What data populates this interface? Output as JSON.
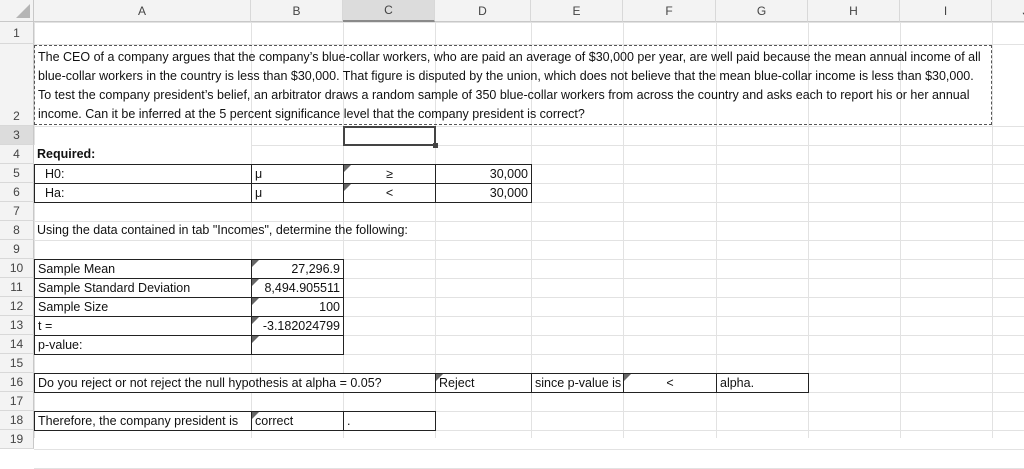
{
  "columns": [
    "A",
    "B",
    "C",
    "D",
    "E",
    "F",
    "G",
    "H",
    "I",
    "J"
  ],
  "rows": [
    "1",
    "2",
    "3",
    "4",
    "5",
    "6",
    "7",
    "8",
    "9",
    "10",
    "11",
    "12",
    "13",
    "14",
    "15",
    "16",
    "17",
    "18",
    "19"
  ],
  "problem_text": "The CEO of a company argues that the company’s blue-collar workers, who are paid an average of $30,000 per year, are well paid because the mean annual income of all blue-collar workers in the country is less than $30,000. That figure is disputed by the union, which does not believe that the mean blue-collar income is less than $30,000. To test the company president’s belief, an arbitrator draws a random sample of 350 blue-collar workers from across the country and asks each to report his or her annual income. Can it be inferred at the 5 percent significance level that the company president is correct?",
  "required_label": "Required:",
  "hypotheses": [
    {
      "label": "H0:",
      "param": "μ",
      "op": "≥",
      "value": "30,000"
    },
    {
      "label": "Ha:",
      "param": "μ",
      "op": "<",
      "value": "30,000"
    }
  ],
  "instruction": "Using the data contained in tab \"Incomes\", determine the following:",
  "stats": [
    {
      "label": "Sample Mean",
      "value": "27,296.9"
    },
    {
      "label": "Sample Standard Deviation",
      "value": "8,494.905511"
    },
    {
      "label": "Sample Size",
      "value": "100"
    },
    {
      "label": "t =",
      "value": "-3.182024799"
    },
    {
      "label": "p-value:",
      "value": ""
    }
  ],
  "decision": {
    "question": "Do you reject or not reject the null hypothesis at alpha = 0.05?",
    "answer": "Reject",
    "since": "since p-value is",
    "op": "<",
    "alpha": "alpha."
  },
  "conclusion": {
    "prefix": "Therefore, the company president is",
    "answer": "correct",
    "end": "."
  }
}
